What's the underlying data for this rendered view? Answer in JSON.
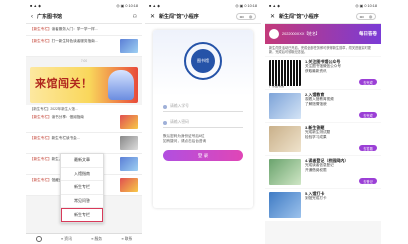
{
  "frame1": {
    "status": {
      "left": "■ ▲ ◆",
      "right": "◎ ▣ 0 10:18"
    },
    "title": "广东图书馆",
    "rows": [
      {
        "tag": "【新生专栏】",
        "text": "读者服务入门：学一学一样..."
      },
      {
        "tag": "【新生专栏】",
        "text": "打一新生特色读者服务指南..."
      }
    ],
    "date_sep": "7:00",
    "banner_text": "来馆闯关！",
    "banner_caption": "【新生专栏】2022年新生入馆...",
    "rows2": [
      {
        "tag": "【新生专栏】",
        "text": "读书分享：借阅指南"
      },
      {
        "tag": "【新生专栏】",
        "text": "新生专栏读书会..."
      },
      {
        "tag": "【新生专栏】",
        "text": "新生入馆"
      },
      {
        "tag": "【新生专栏】",
        "text": "馆藏资源"
      }
    ],
    "menu": [
      "最新文章",
      "入馆指南",
      "新生专栏",
      "常见问答",
      "新生专栏"
    ],
    "tabs": [
      "≡ 资讯",
      "≡ 服务",
      "≡ 联系"
    ]
  },
  "frame2": {
    "status": {
      "left": "■ ▲ ◆",
      "right": "◎ ▣ 0 10:18"
    },
    "title": "新生闯\"馆\"小程序",
    "logo_text": "图书馆",
    "field1": "请输入学号",
    "field2": "请输入密码",
    "note": "默认密码为身份证号后6位\n如有疑问，请点击后台咨询",
    "button": "登 录"
  },
  "frame3": {
    "status": {
      "left": "■ ▲ ◆",
      "right": "◎ ▣ 0 10:18"
    },
    "title": "新生闯\"馆\"小程序",
    "user_id": "2022000XXX【姓名】",
    "badge": "每日答卷",
    "desc": "新生闯关活动已开启，完成全部任务即可获得新生勋章，闯关进度实时更新，完成后可领取纪念品。",
    "qr_caption": "广东图书馆",
    "tasks": [
      {
        "title": "1.关注图书馆公众号",
        "text": "关注图书馆微信公众号\n获取最新资讯",
        "go": "去完成"
      },
      {
        "title": "2.入馆教育",
        "text": "观看入馆教育视频\n了解馆情馆貌",
        "go": "去完成"
      },
      {
        "title": "3.新生答题",
        "text": "完成新生测试题\n检验学习成果",
        "go": "去答题"
      },
      {
        "title": "4.读者登记（校园网内）",
        "text": "完成读者信息登记\n开通借阅权限",
        "go": "去登记"
      },
      {
        "title": "5.入馆打卡",
        "text": "到馆完成打卡",
        "go": ""
      }
    ]
  }
}
